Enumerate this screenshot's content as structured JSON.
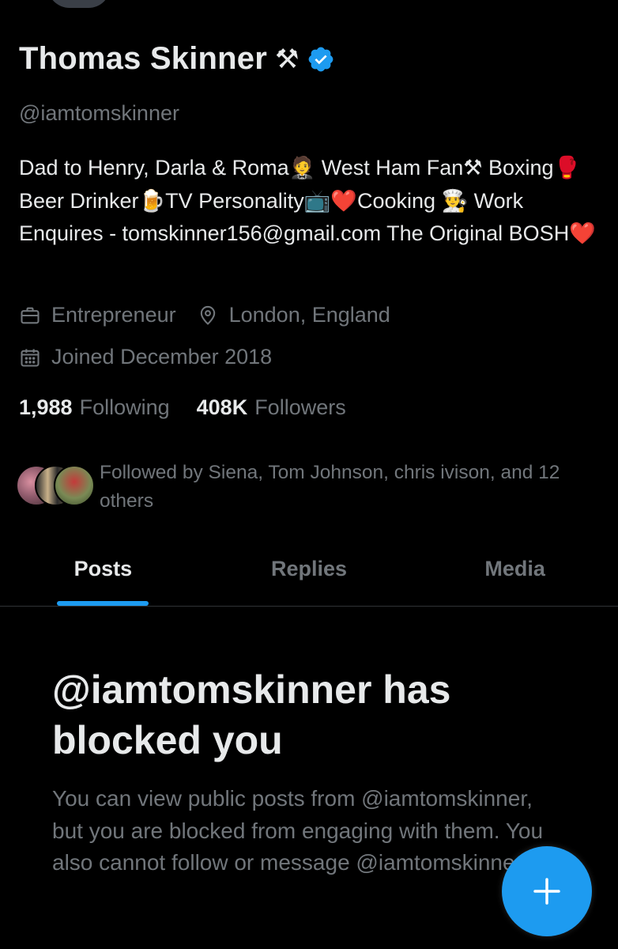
{
  "profile": {
    "display_name": "Thomas Skinner",
    "name_emoji": "⚒",
    "handle": "@iamtomskinner",
    "bio": "Dad to Henry, Darla & Roma🤵 West Ham Fan⚒ Boxing🥊Beer Drinker🍺TV Personality📺❤️Cooking 👨‍🍳 Work Enquires - tomskinner156@gmail.com The Original BOSH❤️",
    "occupation": "Entrepreneur",
    "location": "London, England",
    "joined": "Joined December 2018",
    "following_count": "1,988",
    "following_label": "Following",
    "followers_count": "408K",
    "followers_label": "Followers",
    "followed_by": "Followed by Siena, Tom Johnson, chris ivison, and 12 others"
  },
  "tabs": [
    {
      "label": "Posts",
      "active": true
    },
    {
      "label": "Replies",
      "active": false
    },
    {
      "label": "Media",
      "active": false
    }
  ],
  "blocked": {
    "title": "@iamtomskinner has blocked you",
    "body": "You can view public posts from @iamtomskinner, but you are blocked from engaging with them. You also cannot follow or message @iamtomskinner."
  },
  "fab": {
    "icon": "plus-icon",
    "glyph": "+"
  },
  "colors": {
    "background": "#000000",
    "primary_text": "#e7e9ea",
    "secondary_text": "#71767b",
    "accent": "#1d9bf0",
    "divider": "#2f3336"
  }
}
